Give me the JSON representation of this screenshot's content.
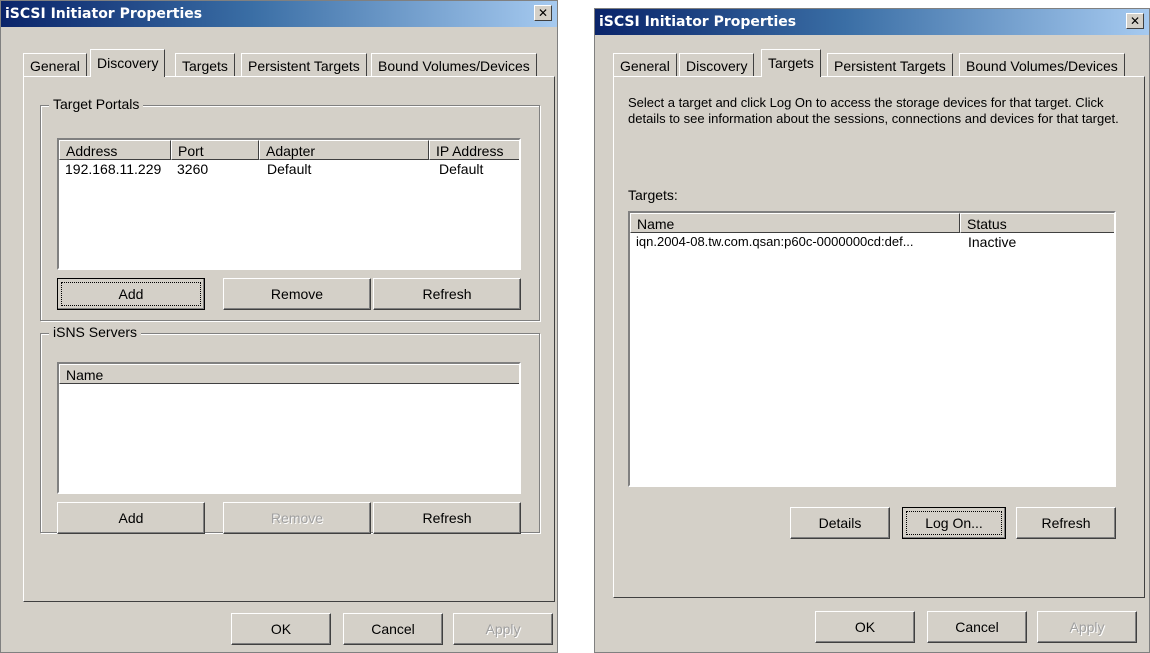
{
  "windows": [
    {
      "title": "iSCSI Initiator Properties",
      "tabs": [
        "General",
        "Discovery",
        "Targets",
        "Persistent Targets",
        "Bound Volumes/Devices"
      ],
      "active_tab": "Discovery",
      "target_portals": {
        "label": "Target Portals",
        "columns": [
          "Address",
          "Port",
          "Adapter",
          "IP Address"
        ],
        "rows": [
          [
            "192.168.11.229",
            "3260",
            "Default",
            "Default"
          ]
        ],
        "buttons": [
          "Add",
          "Remove",
          "Refresh"
        ]
      },
      "isns_servers": {
        "label": "iSNS Servers",
        "columns": [
          "Name"
        ],
        "buttons": [
          "Add",
          "Remove",
          "Refresh"
        ]
      },
      "footer_buttons": [
        "OK",
        "Cancel",
        "Apply"
      ]
    },
    {
      "title": "iSCSI Initiator Properties",
      "tabs": [
        "General",
        "Discovery",
        "Targets",
        "Persistent Targets",
        "Bound Volumes/Devices"
      ],
      "active_tab": "Targets",
      "description": "Select a target and click Log On to access the storage devices for that target. Click details to see information about the sessions, connections and devices for that target.",
      "targets_label": "Targets:",
      "columns": [
        "Name",
        "Status"
      ],
      "rows": [
        [
          "iqn.2004-08.tw.com.qsan:p60c-0000000cd:def...",
          "Inactive"
        ]
      ],
      "buttons": [
        "Details",
        "Log On...",
        "Refresh"
      ],
      "footer_buttons": [
        "OK",
        "Cancel",
        "Apply"
      ]
    }
  ]
}
